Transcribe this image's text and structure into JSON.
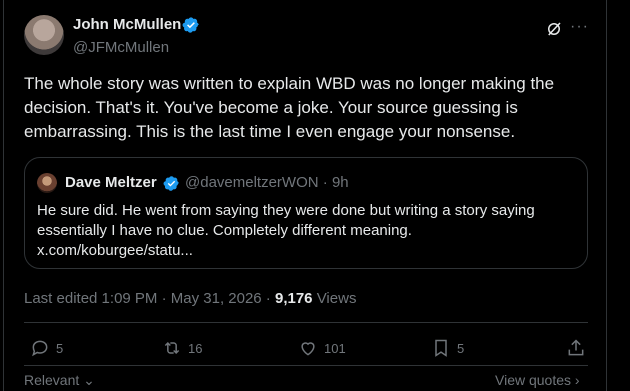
{
  "author": {
    "name": "John McMullen",
    "handle": "@JFMcMullen"
  },
  "icons": {
    "verified": "verified-badge",
    "grok": "grok-icon",
    "more": "more-icon"
  },
  "tweet_text": "The whole story was written to explain WBD was no longer making the decision. That's it. You've become a joke. Your source guessing is embarrassing. This is the last time I even engage your nonsense.",
  "quoted": {
    "name": "Dave Meltzer",
    "handle": "@davemeltzerWON",
    "time": "9h",
    "text": "He sure did.  He went from saying  they were done but writing a story saying essentially I have no clue.  Completely different meaning.",
    "link": "x.com/koburgee/statu..."
  },
  "meta": {
    "edited": "Last edited 1:09 PM · May 31, 2026 · ",
    "views_count": "9,176",
    "views_label": " Views"
  },
  "actions": {
    "replies": "5",
    "reposts": "16",
    "likes": "101",
    "bookmarks": "5"
  },
  "footer": {
    "relevant": "Relevant",
    "view_quotes": "View quotes"
  },
  "colors": {
    "background": "#000000",
    "text": "#e7e9ea",
    "muted": "#71767b",
    "verified": "#1d9bf0",
    "border": "#2f3336"
  }
}
